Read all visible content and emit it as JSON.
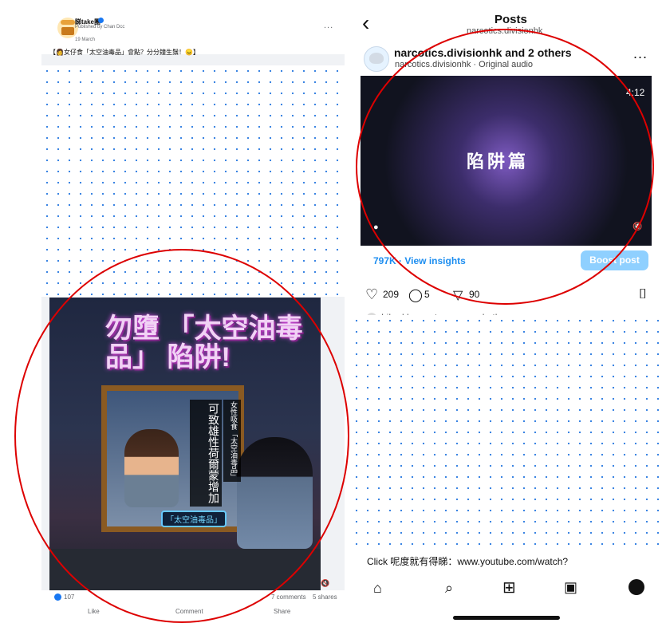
{
  "facebook": {
    "page_name": "睇take團",
    "published_by": "Published by Chan Dcc",
    "date": "19 March",
    "caption": "【👩女仔食「太空油毒品」會點？分分鐘生鬚！😠】",
    "poster": {
      "title": "勿墮\n「太空油毒品」\n陷阱!",
      "vertical_text": "可致雄性荷爾蒙增加",
      "side_text": "女性吸食「太空油毒品」",
      "caption": "「太空油毒品」"
    },
    "actions": {
      "reactions": "107",
      "comments": "7 comments",
      "shares": "5 shares",
      "like": "Like",
      "comment": "Comment",
      "share": "Share"
    }
  },
  "instagram": {
    "header_title": "Posts",
    "header_subtitle": "narcotics.divisionhk",
    "post_user": "narcotics.divisionhk and 2 others",
    "audio": "narcotics.divisionhk · Original audio",
    "video_text": "陷阱篇",
    "duration": "4:12",
    "views": "797K · View insights",
    "boost": "Boost post",
    "likes": "209",
    "comments": "5",
    "shares": "90",
    "liked_by": "Liked by customguy and others",
    "caption_line": "Click 呢度就有得睇：www.youtube.com/watch?"
  },
  "icons": {
    "back": "‹",
    "more": "...",
    "heart": "♡",
    "comment": "◯",
    "send": "▽",
    "bookmark": "⌷",
    "home": "⌂",
    "search": "⌕",
    "create": "⊞",
    "reels": "▣"
  }
}
